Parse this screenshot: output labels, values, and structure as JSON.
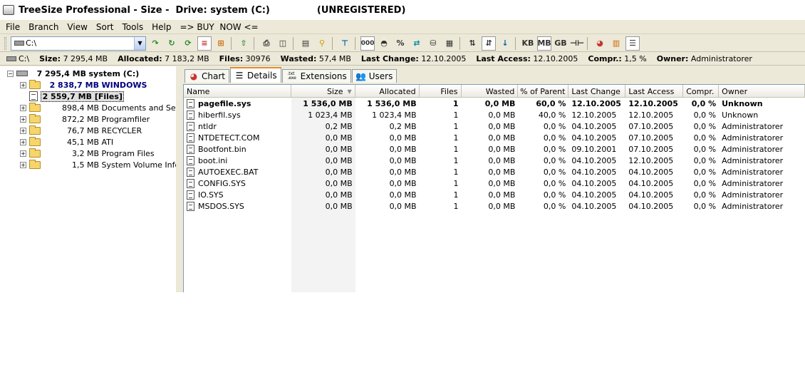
{
  "window": {
    "title": "TreeSize Professional - Size -  Drive: system (C:)",
    "status": "(UNREGISTERED)"
  },
  "menu": [
    "File",
    "Branch",
    "View",
    "Sort",
    "Tools",
    "Help",
    "=> BUY  NOW <="
  ],
  "toolbar": {
    "drive_value": "C:\\",
    "units": [
      "KB",
      "MB",
      "GB"
    ],
    "active_unit": "MB",
    "percent_label": "%",
    "count_label": "000"
  },
  "infobar": {
    "path": "C:\\",
    "size_label": "Size:",
    "size_value": "7 295,4  MB",
    "allocated_label": "Allocated:",
    "allocated_value": "7 183,2  MB",
    "files_label": "Files:",
    "files_value": "30976",
    "wasted_label": "Wasted:",
    "wasted_value": "57,4  MB",
    "last_change_label": "Last Change:",
    "last_change_value": "12.10.2005",
    "last_access_label": "Last Access:",
    "last_access_value": "12.10.2005",
    "compr_label": "Compr.:",
    "compr_value": "1,5 %",
    "owner_label": "Owner:",
    "owner_value": "Administratorer"
  },
  "tree": {
    "root": {
      "size": "7 295,4  MB",
      "name": "system (C:)"
    },
    "children": [
      {
        "size": "2 838,7  MB",
        "name": "WINDOWS"
      },
      {
        "size": "2 559,7  MB",
        "name": "[Files]"
      },
      {
        "size": "898,4  MB",
        "name": "Documents and Settings"
      },
      {
        "size": "872,2  MB",
        "name": "Programfiler"
      },
      {
        "size": "76,7  MB",
        "name": "RECYCLER"
      },
      {
        "size": "45,1  MB",
        "name": "ATI"
      },
      {
        "size": "3,2  MB",
        "name": "Program Files"
      },
      {
        "size": "1,5  MB",
        "name": "System Volume Informat"
      }
    ]
  },
  "tabs": [
    {
      "label": "Chart",
      "icon": "pie-chart-icon"
    },
    {
      "label": "Details",
      "icon": "details-list-icon"
    },
    {
      "label": "Extensions",
      "icon": "extensions-icon"
    },
    {
      "label": "Users",
      "icon": "users-icon"
    }
  ],
  "ext_icon_text": ".txt\n.exe",
  "columns": [
    "Name",
    "Size",
    "Allocated",
    "Files",
    "Wasted",
    "% of Parent",
    "Last Change",
    "Last Access",
    "Compr.",
    "Owner"
  ],
  "rows": [
    [
      "pagefile.sys",
      "1 536,0  MB",
      "1 536,0  MB",
      "1",
      "0,0  MB",
      "60,0 %",
      "12.10.2005",
      "12.10.2005",
      "0,0 %",
      "Unknown"
    ],
    [
      "hiberfil.sys",
      "1 023,4  MB",
      "1 023,4  MB",
      "1",
      "0,0  MB",
      "40,0 %",
      "12.10.2005",
      "12.10.2005",
      "0,0 %",
      "Unknown"
    ],
    [
      "ntldr",
      "0,2  MB",
      "0,2  MB",
      "1",
      "0,0  MB",
      "0,0 %",
      "04.10.2005",
      "07.10.2005",
      "0,0 %",
      "Administratorer"
    ],
    [
      "NTDETECT.COM",
      "0,0  MB",
      "0,0  MB",
      "1",
      "0,0  MB",
      "0,0 %",
      "04.10.2005",
      "07.10.2005",
      "0,0 %",
      "Administratorer"
    ],
    [
      "Bootfont.bin",
      "0,0  MB",
      "0,0  MB",
      "1",
      "0,0  MB",
      "0,0 %",
      "09.10.2001",
      "07.10.2005",
      "0,0 %",
      "Administratorer"
    ],
    [
      "boot.ini",
      "0,0  MB",
      "0,0  MB",
      "1",
      "0,0  MB",
      "0,0 %",
      "04.10.2005",
      "12.10.2005",
      "0,0 %",
      "Administratorer"
    ],
    [
      "AUTOEXEC.BAT",
      "0,0  MB",
      "0,0  MB",
      "1",
      "0,0  MB",
      "0,0 %",
      "04.10.2005",
      "04.10.2005",
      "0,0 %",
      "Administratorer"
    ],
    [
      "CONFIG.SYS",
      "0,0  MB",
      "0,0  MB",
      "1",
      "0,0  MB",
      "0,0 %",
      "04.10.2005",
      "04.10.2005",
      "0,0 %",
      "Administratorer"
    ],
    [
      "IO.SYS",
      "0,0  MB",
      "0,0  MB",
      "1",
      "0,0  MB",
      "0,0 %",
      "04.10.2005",
      "04.10.2005",
      "0,0 %",
      "Administratorer"
    ],
    [
      "MSDOS.SYS",
      "0,0  MB",
      "0,0  MB",
      "1",
      "0,0  MB",
      "0,0 %",
      "04.10.2005",
      "04.10.2005",
      "0,0 %",
      "Administratorer"
    ]
  ]
}
